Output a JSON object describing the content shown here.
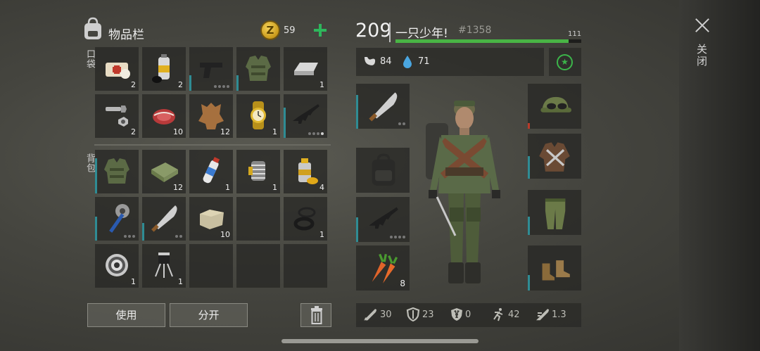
{
  "inventory": {
    "title": "物品栏",
    "coins": "59",
    "coin_symbol": "Z",
    "pocket_label": "口袋",
    "backpack_label": "背包",
    "pocket_items": [
      {
        "name": "bandage-icon",
        "count": "2",
        "dura": 0,
        "dots": 0
      },
      {
        "name": "spray-can-icon",
        "count": "2",
        "dura": 0,
        "dots": 0
      },
      {
        "name": "pistol-icon",
        "count": "",
        "dura": 0.35,
        "dots": 4,
        "dots_on": 0
      },
      {
        "name": "vest-icon",
        "count": "",
        "dura": 0.35,
        "dots": 0
      },
      {
        "name": "metal-ingot-icon",
        "count": "1",
        "dura": 0,
        "dots": 0
      },
      {
        "name": "bolt-nut-icon",
        "count": "2",
        "dura": 0,
        "dots": 0
      },
      {
        "name": "raw-meat-icon",
        "count": "10",
        "dura": 0,
        "dots": 0
      },
      {
        "name": "leather-hide-icon",
        "count": "12",
        "dura": 0,
        "dots": 0
      },
      {
        "name": "gold-watch-icon",
        "count": "1",
        "dura": 0,
        "dots": 0
      },
      {
        "name": "assault-rifle-icon",
        "count": "",
        "dura": 0.7,
        "dots": 4,
        "dots_on": 1
      }
    ],
    "backpack_items": [
      {
        "name": "vest-icon",
        "count": "",
        "dura": 0.8,
        "dots": 0
      },
      {
        "name": "cloth-icon",
        "count": "12",
        "dura": 0,
        "dots": 0
      },
      {
        "name": "medicine-tube-icon",
        "count": "1",
        "dura": 0,
        "dots": 0
      },
      {
        "name": "spring-coil-icon",
        "count": "1",
        "dura": 0,
        "dots": 0
      },
      {
        "name": "gas-canister-icon",
        "count": "4",
        "dura": 0,
        "dots": 0
      },
      {
        "name": "saw-mace-icon",
        "count": "",
        "dura": 0.55,
        "dots": 3,
        "dots_on": 0
      },
      {
        "name": "machete-icon",
        "count": "",
        "dura": 0.4,
        "dots": 2,
        "dots_on": 0
      },
      {
        "name": "stone-block-icon",
        "count": "10",
        "dura": 0,
        "dots": 0
      },
      {
        "name": "empty-slot",
        "count": "",
        "dura": 0,
        "dots": 0
      },
      {
        "name": "rubber-seal-icon",
        "count": "1",
        "dura": 0,
        "dots": 0
      },
      {
        "name": "ball-bearing-icon",
        "count": "1",
        "dura": 0,
        "dots": 0
      },
      {
        "name": "transistor-icon",
        "count": "1",
        "dura": 0,
        "dots": 0
      },
      {
        "name": "empty-slot",
        "count": "",
        "dura": 0,
        "dots": 0
      },
      {
        "name": "empty-slot",
        "count": "",
        "dura": 0,
        "dots": 0
      },
      {
        "name": "empty-slot",
        "count": "",
        "dura": 0,
        "dots": 0
      }
    ],
    "use_label": "使用",
    "split_label": "分开"
  },
  "player": {
    "level": "209",
    "name": "一只少年!",
    "id": "#1358",
    "xp_value": "111",
    "xp_fraction": 0.93,
    "hunger": "84",
    "thirst": "71"
  },
  "equipment": {
    "left": [
      {
        "name": "machete-icon",
        "count": "",
        "dura": 0.75,
        "dots": 2
      },
      {
        "name": "backpack-icon",
        "count": "",
        "dura": 0,
        "dots": 0
      },
      {
        "name": "assault-rifle-icon",
        "count": "",
        "dura": 0.55,
        "dots": 4
      },
      {
        "name": "carrot-icon",
        "count": "8",
        "dura": 0,
        "dots": 0
      }
    ],
    "right": [
      {
        "name": "camo-cap-icon",
        "dura": 0.12,
        "dura_color": "#b83a2a"
      },
      {
        "name": "armor-jacket-icon",
        "dura": 0.5,
        "dura_color": "#2f8c94"
      },
      {
        "name": "camo-pants-icon",
        "dura": 0.4,
        "dura_color": "#2f8c94"
      },
      {
        "name": "boots-icon",
        "dura": 0.35,
        "dura_color": "#2f8c94"
      }
    ]
  },
  "combat_stats": {
    "attack": "30",
    "defense": "23",
    "radiation": "0",
    "speed": "42",
    "weight": "1.3"
  },
  "close_label": "关闭",
  "colors": {
    "accent_green": "#49b445",
    "durability_teal": "#2f8c94",
    "durability_red": "#b83a2a"
  }
}
